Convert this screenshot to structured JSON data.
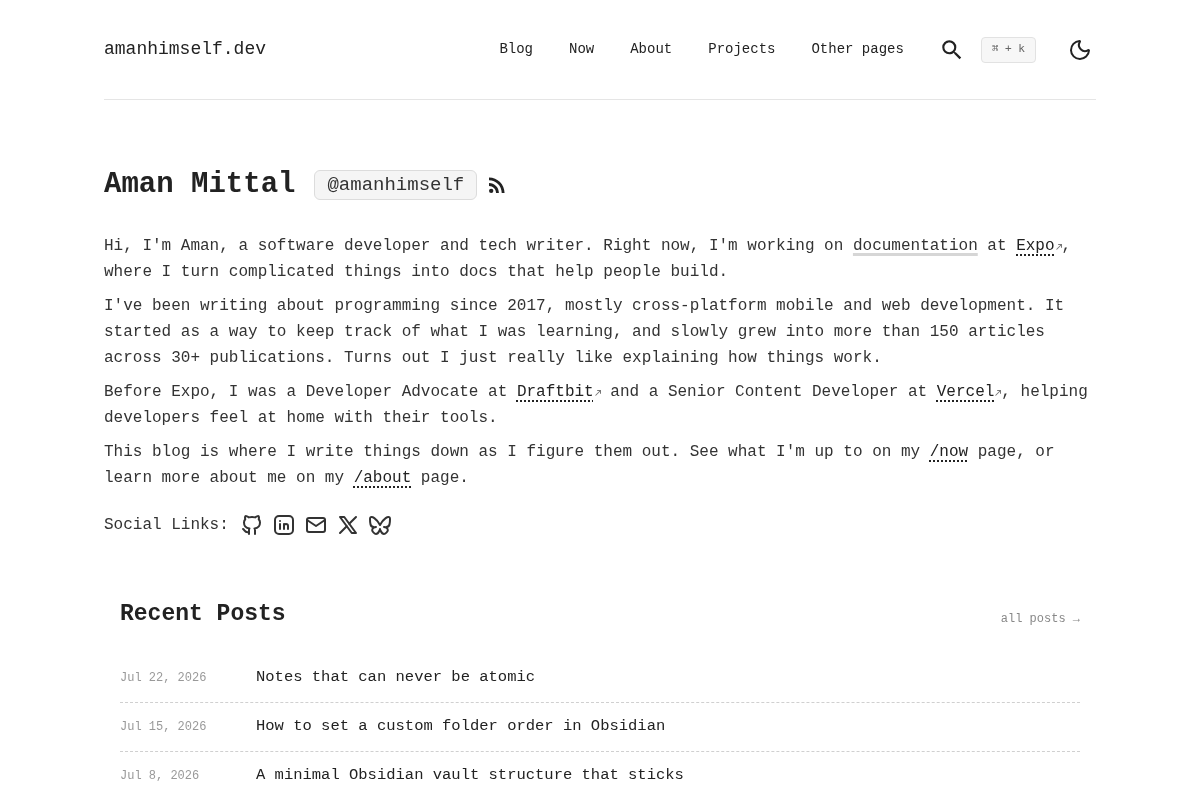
{
  "header": {
    "site_title": "amanhimself.dev",
    "nav": [
      {
        "label": "Blog"
      },
      {
        "label": "Now"
      },
      {
        "label": "About"
      },
      {
        "label": "Projects"
      },
      {
        "label": "Other pages"
      }
    ],
    "shortcut": "⌘ + k"
  },
  "hero": {
    "name": "Aman Mittal",
    "handle": "@amanhimself"
  },
  "intro": [
    {
      "segments": [
        {
          "kind": "text",
          "text": "Hi, I'm Aman, a software developer and tech writer. Right now, I'm working on "
        },
        {
          "kind": "highlight",
          "text": "documentation"
        },
        {
          "kind": "text",
          "text": " at "
        },
        {
          "kind": "external",
          "text": "Expo"
        },
        {
          "kind": "text",
          "text": ", where I turn complicated things into docs that help people build."
        }
      ]
    },
    {
      "segments": [
        {
          "kind": "text",
          "text": "I've been writing about programming since 2017, mostly cross-platform mobile and web development. It started as a way to keep track of what I was learning, and slowly grew into more than 150 articles across 30+ publications. Turns out I just really like explaining how things work."
        }
      ]
    },
    {
      "segments": [
        {
          "kind": "text",
          "text": "Before Expo, I was a Developer Advocate at "
        },
        {
          "kind": "external",
          "text": "Draftbit"
        },
        {
          "kind": "text",
          "text": " and a Senior Content Developer at "
        },
        {
          "kind": "external",
          "text": "Vercel"
        },
        {
          "kind": "text",
          "text": ", helping developers feel at home with their tools."
        }
      ]
    },
    {
      "segments": [
        {
          "kind": "text",
          "text": "This blog is where I write things down as I figure them out. See what I'm up to on my "
        },
        {
          "kind": "link",
          "text": "/now"
        },
        {
          "kind": "text",
          "text": " page, or learn more about me on my "
        },
        {
          "kind": "link",
          "text": "/about"
        },
        {
          "kind": "text",
          "text": " page."
        }
      ]
    }
  ],
  "social": {
    "label": "Social Links:"
  },
  "recent_posts": {
    "title": "Recent Posts",
    "all_posts": "all posts →",
    "posts": [
      {
        "date": "Jul 22, 2026",
        "title": "Notes that can never be atomic"
      },
      {
        "date": "Jul 15, 2026",
        "title": "How to set a custom folder order in Obsidian"
      },
      {
        "date": "Jul 8, 2026",
        "title": "A minimal Obsidian vault structure that sticks"
      }
    ]
  }
}
